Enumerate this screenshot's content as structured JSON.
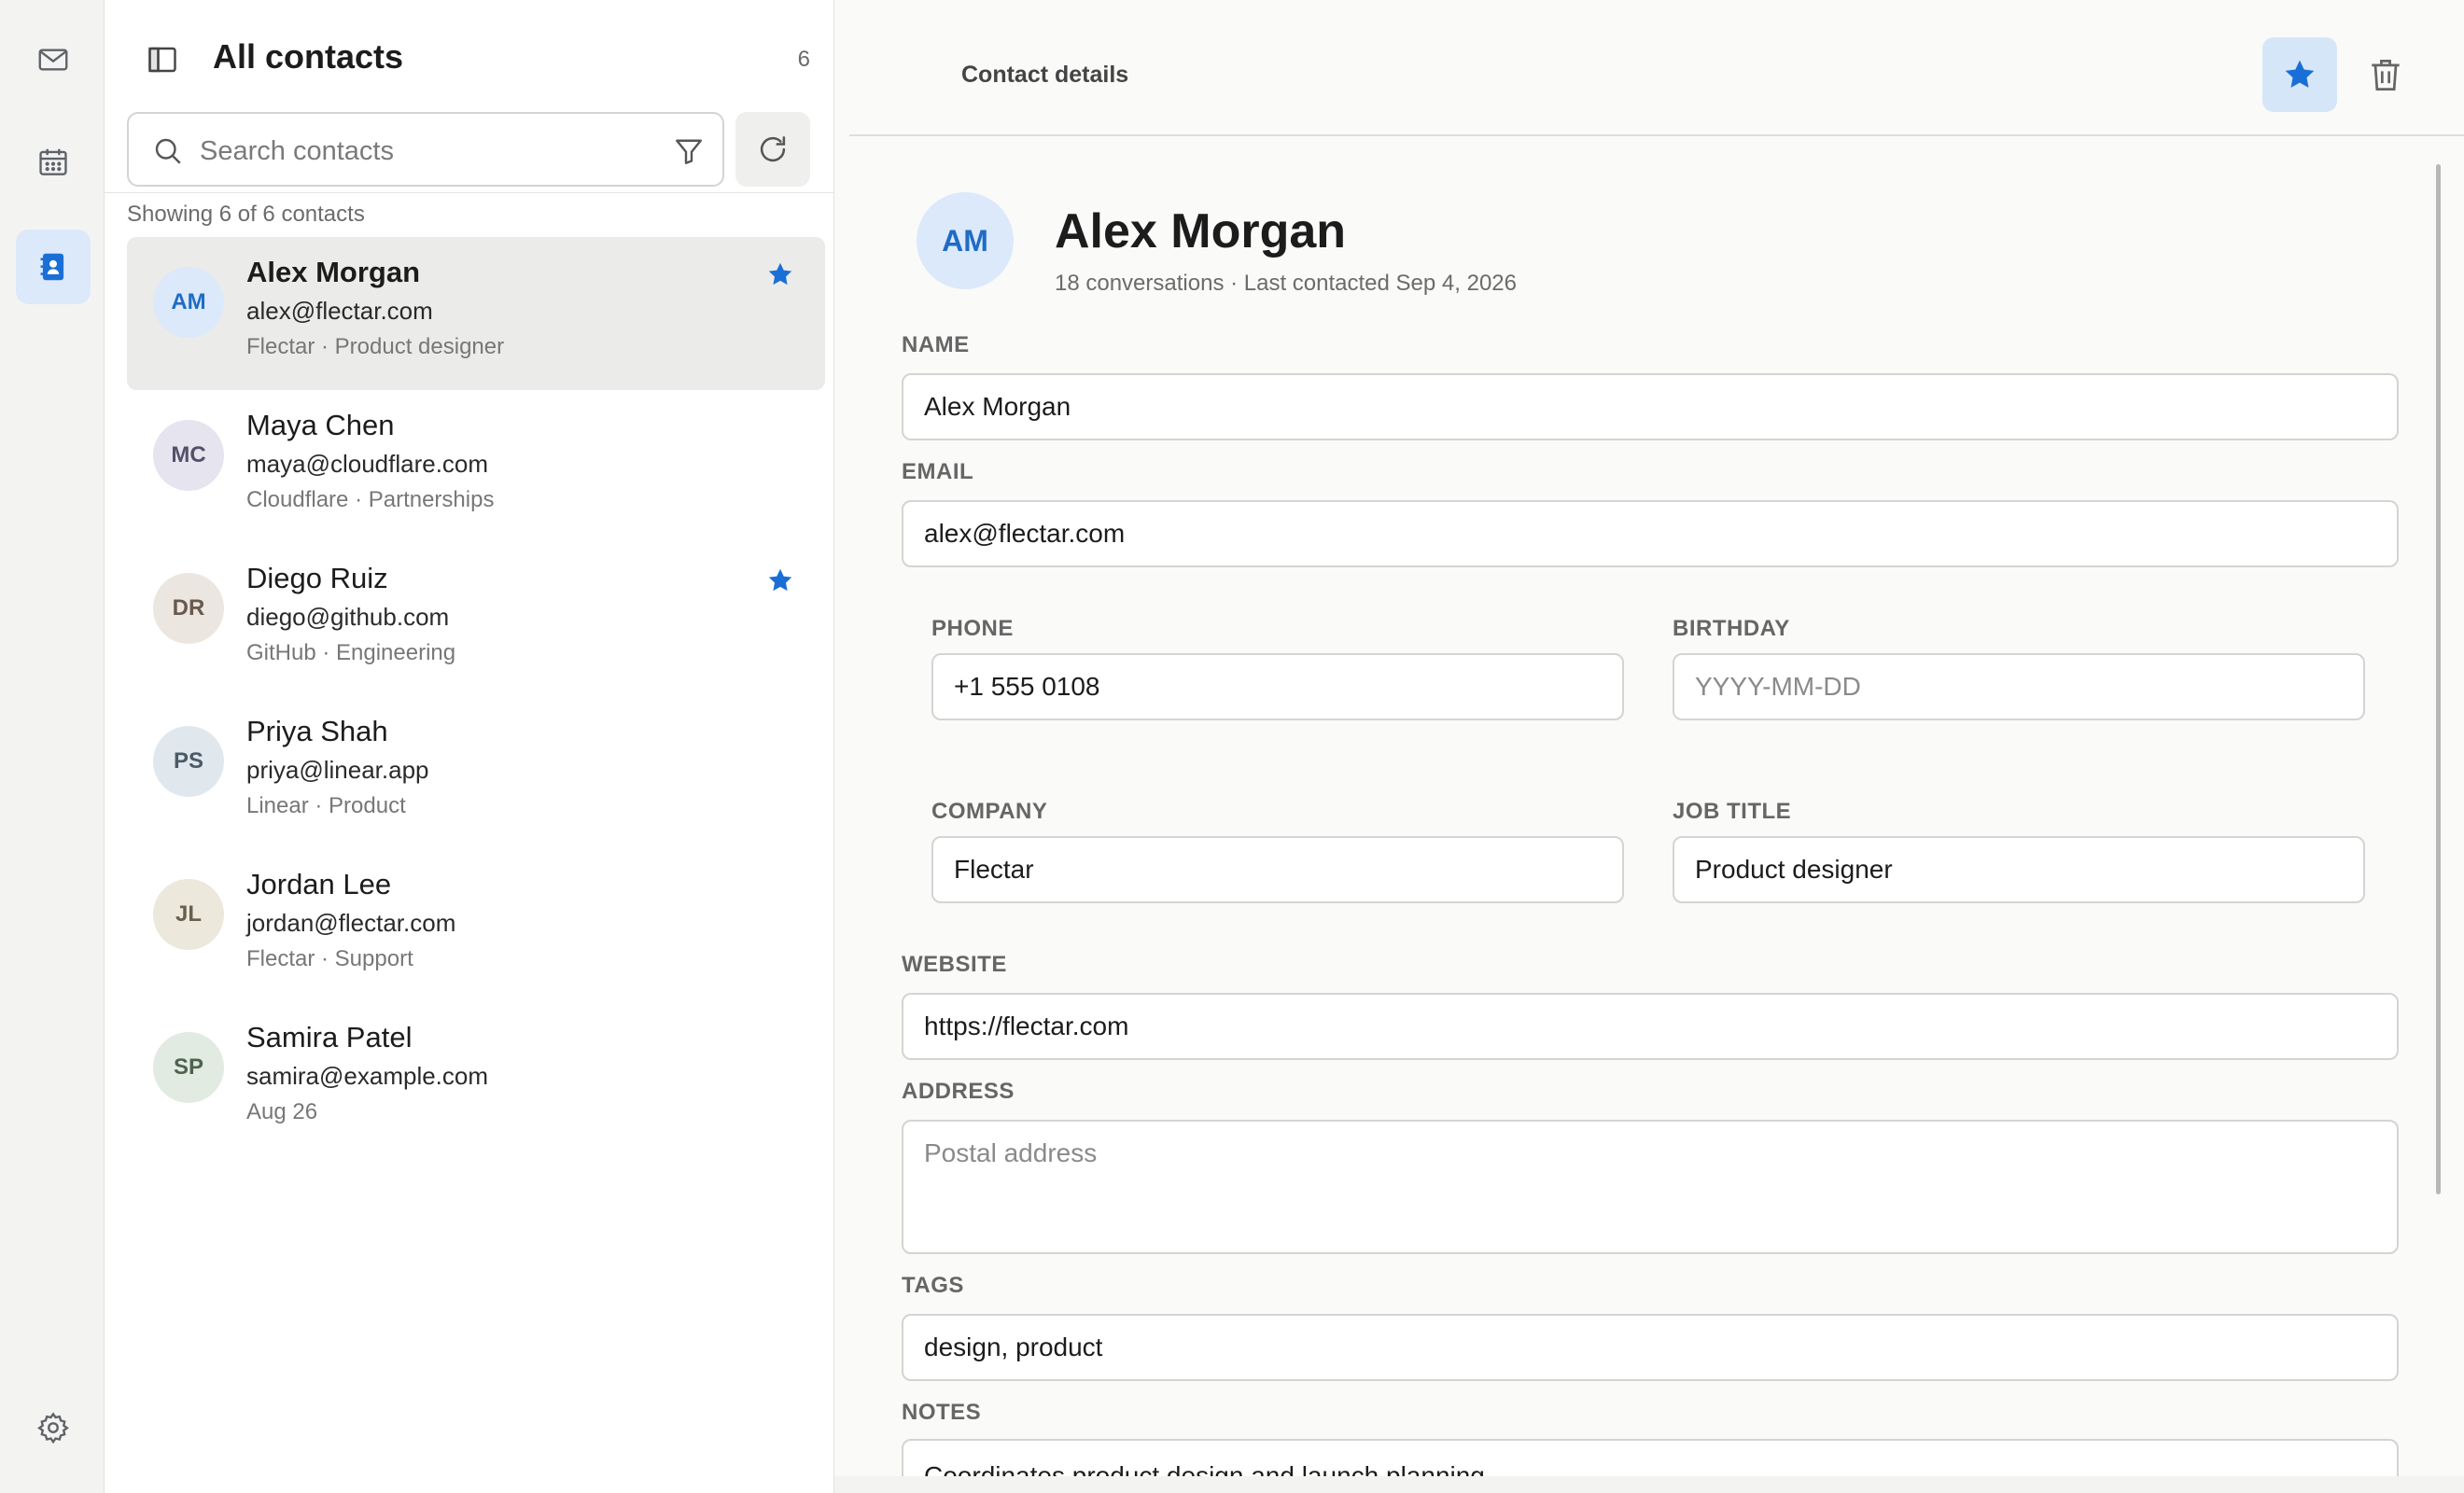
{
  "rail": {
    "items": [
      {
        "name": "mail",
        "icon": "mail-icon"
      },
      {
        "name": "calendar",
        "icon": "calendar-icon"
      },
      {
        "name": "contacts",
        "icon": "contacts-icon",
        "active": true
      }
    ],
    "settings_icon": "gear-icon"
  },
  "list": {
    "title": "All contacts",
    "count": "6",
    "search_placeholder": "Search contacts",
    "showing": "Showing 6 of 6 contacts",
    "contacts": [
      {
        "initials": "AM",
        "name": "Alex Morgan",
        "email": "alex@flectar.com",
        "meta": "Flectar · Product designer",
        "starred": true,
        "selected": true,
        "avatar_bg": "#dbe9fa",
        "avatar_fg": "#1f6cc4"
      },
      {
        "initials": "MC",
        "name": "Maya Chen",
        "email": "maya@cloudflare.com",
        "meta": "Cloudflare · Partnerships",
        "starred": false,
        "selected": false,
        "avatar_bg": "#e6e4ef",
        "avatar_fg": "#54506a"
      },
      {
        "initials": "DR",
        "name": "Diego Ruiz",
        "email": "diego@github.com",
        "meta": "GitHub · Engineering",
        "starred": true,
        "selected": false,
        "avatar_bg": "#ece6e0",
        "avatar_fg": "#6a5a4c"
      },
      {
        "initials": "PS",
        "name": "Priya Shah",
        "email": "priya@linear.app",
        "meta": "Linear · Product",
        "starred": false,
        "selected": false,
        "avatar_bg": "#e0e8ee",
        "avatar_fg": "#4a5a66"
      },
      {
        "initials": "JL",
        "name": "Jordan Lee",
        "email": "jordan@flectar.com",
        "meta": "Flectar · Support",
        "starred": false,
        "selected": false,
        "avatar_bg": "#ece8dc",
        "avatar_fg": "#66604c"
      },
      {
        "initials": "SP",
        "name": "Samira Patel",
        "email": "samira@example.com",
        "meta": "Aug 26",
        "starred": false,
        "selected": false,
        "avatar_bg": "#e2ebe2",
        "avatar_fg": "#4e634e"
      }
    ]
  },
  "detail": {
    "title": "Contact details",
    "initials": "AM",
    "name": "Alex Morgan",
    "subtitle": "18 conversations · Last contacted Sep 4, 2026",
    "fields": {
      "name": {
        "label": "NAME",
        "value": "Alex Morgan"
      },
      "email": {
        "label": "EMAIL",
        "value": "alex@flectar.com"
      },
      "phone": {
        "label": "PHONE",
        "value": "+1 555 0108"
      },
      "birthday": {
        "label": "BIRTHDAY",
        "value": "",
        "placeholder": "YYYY-MM-DD"
      },
      "company": {
        "label": "COMPANY",
        "value": "Flectar"
      },
      "job_title": {
        "label": "JOB TITLE",
        "value": "Product designer"
      },
      "website": {
        "label": "WEBSITE",
        "value": "https://flectar.com"
      },
      "address": {
        "label": "ADDRESS",
        "value": "",
        "placeholder": "Postal address"
      },
      "tags": {
        "label": "TAGS",
        "value": "design, product"
      },
      "notes": {
        "label": "NOTES",
        "value": "Coordinates product design and launch planning."
      }
    }
  },
  "colors": {
    "accent": "#1a6fd6",
    "accent_soft": "#dbe9fa",
    "star": "#1a6fd6"
  }
}
